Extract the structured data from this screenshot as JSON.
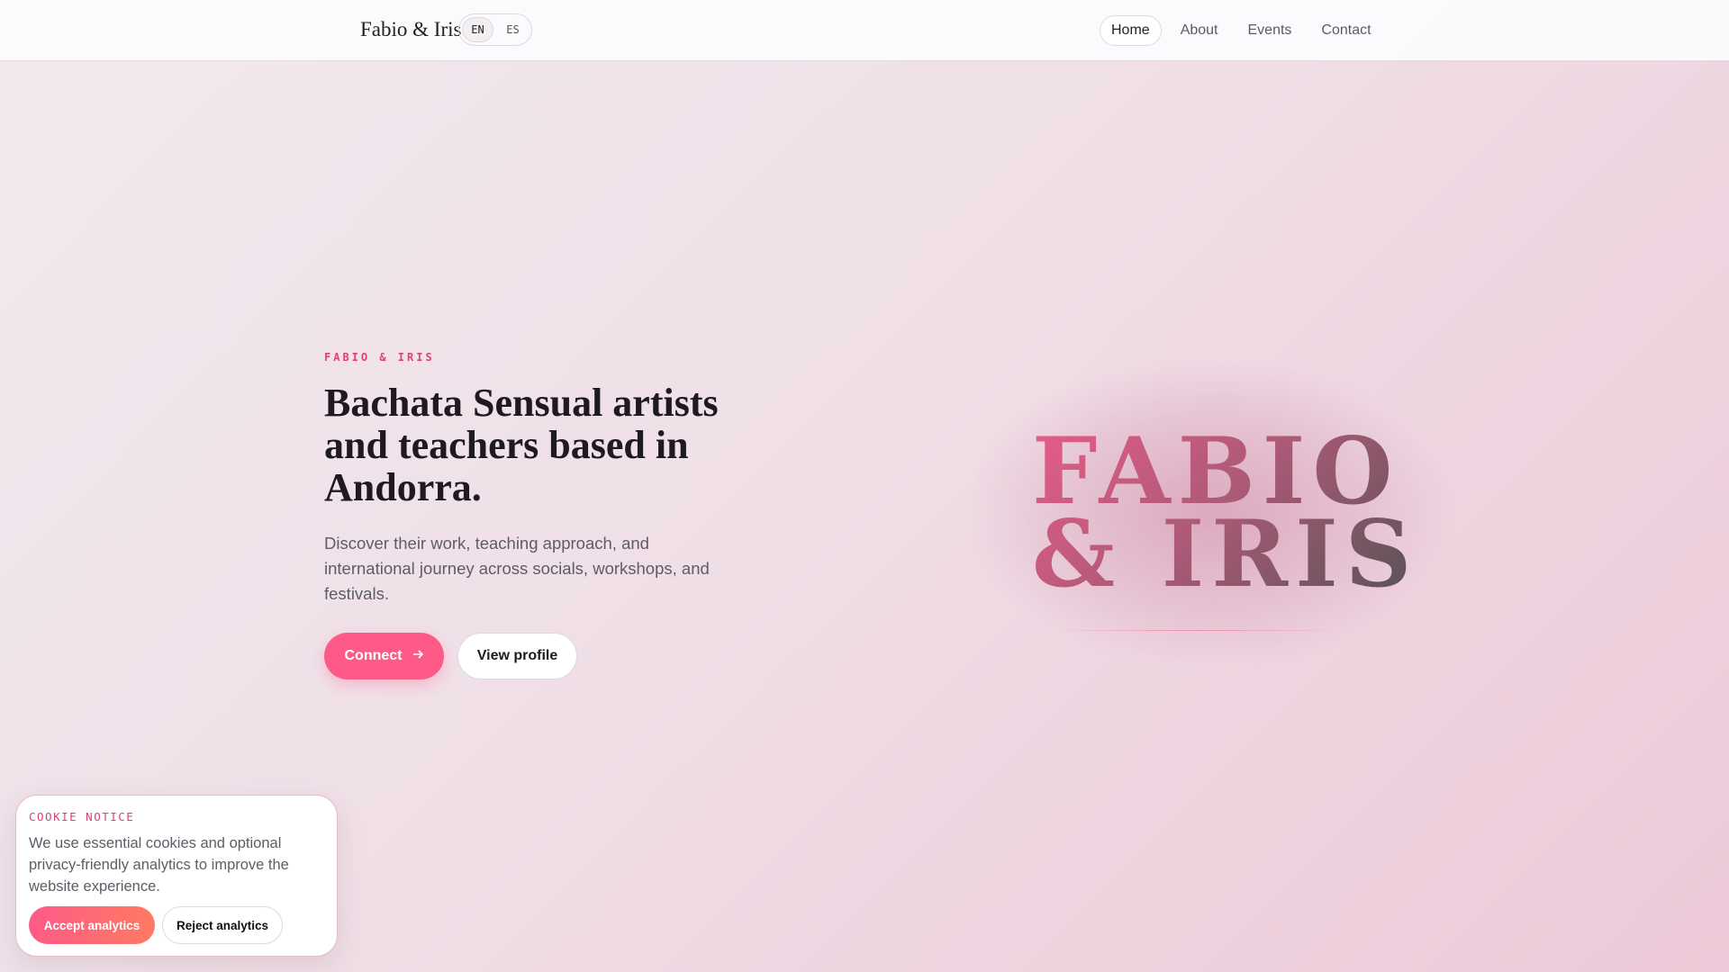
{
  "header": {
    "brand": "Fabio & Iris",
    "languages": [
      "EN",
      "ES"
    ],
    "active_language": "EN",
    "nav": [
      "Home",
      "About",
      "Events",
      "Contact"
    ],
    "active_nav": "Home"
  },
  "hero": {
    "eyebrow": "FABIO & IRIS",
    "title": "Bachata Sensual artists and teachers based in Andorra.",
    "lead": "Discover their work, teaching approach, and international journey across socials, workshops, and festivals.",
    "connect_label": "Connect",
    "view_profile_label": "View profile",
    "display_text": "FABIO\n& IRIS"
  },
  "cookie": {
    "label": "COOKIE NOTICE",
    "text": "We use essential cookies and optional privacy-friendly analytics to improve the website experience.",
    "accept_label": "Accept analytics",
    "reject_label": "Reject analytics"
  },
  "colors": {
    "accent": "#fe5a88",
    "eyebrow": "#e0416f"
  }
}
